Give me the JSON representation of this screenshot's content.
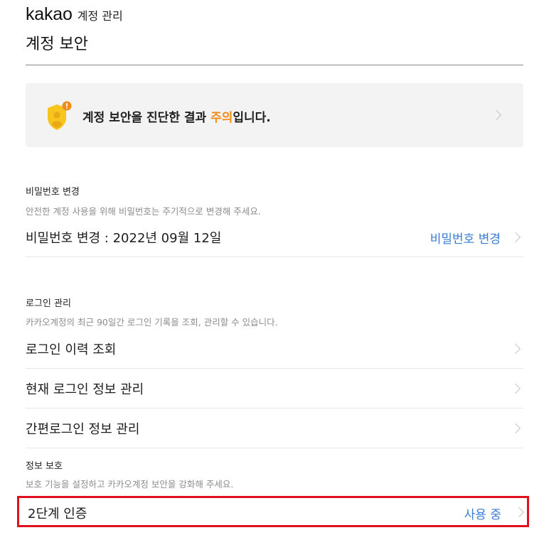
{
  "header": {
    "brand": "kakao",
    "brand_sub": "계정 관리",
    "page_title": "계정 보안"
  },
  "banner": {
    "text_before": "계정 보안을 진단한 결과 ",
    "status": "주의",
    "text_after": "입니다.",
    "icon": "shield-warning-icon",
    "status_color": "#f28a18"
  },
  "password": {
    "title": "비밀번호 변경",
    "desc": "안전한 계정 사용을 위해 비밀번호는 주기적으로 변경해 주세요.",
    "row_label": "비밀번호 변경 : 2022년 09월 12일",
    "action": "비밀번호 변경"
  },
  "login": {
    "title": "로그인 관리",
    "desc": "카카오계정의 최근 90일간 로그인 기록을 조회, 관리할 수 있습니다.",
    "items": [
      {
        "label": "로그인 이력 조회"
      },
      {
        "label": "현재 로그인 정보 관리"
      },
      {
        "label": "간편로그인 정보 관리"
      }
    ]
  },
  "protection": {
    "title": "정보 보호",
    "desc": "보호 기능을 설정하고 카카오계정 보안을 강화해 주세요.",
    "two_factor_label": "2단계 인증",
    "two_factor_status": "사용 중"
  },
  "colors": {
    "link": "#3a7bd5",
    "highlight_border": "#e0101c"
  }
}
